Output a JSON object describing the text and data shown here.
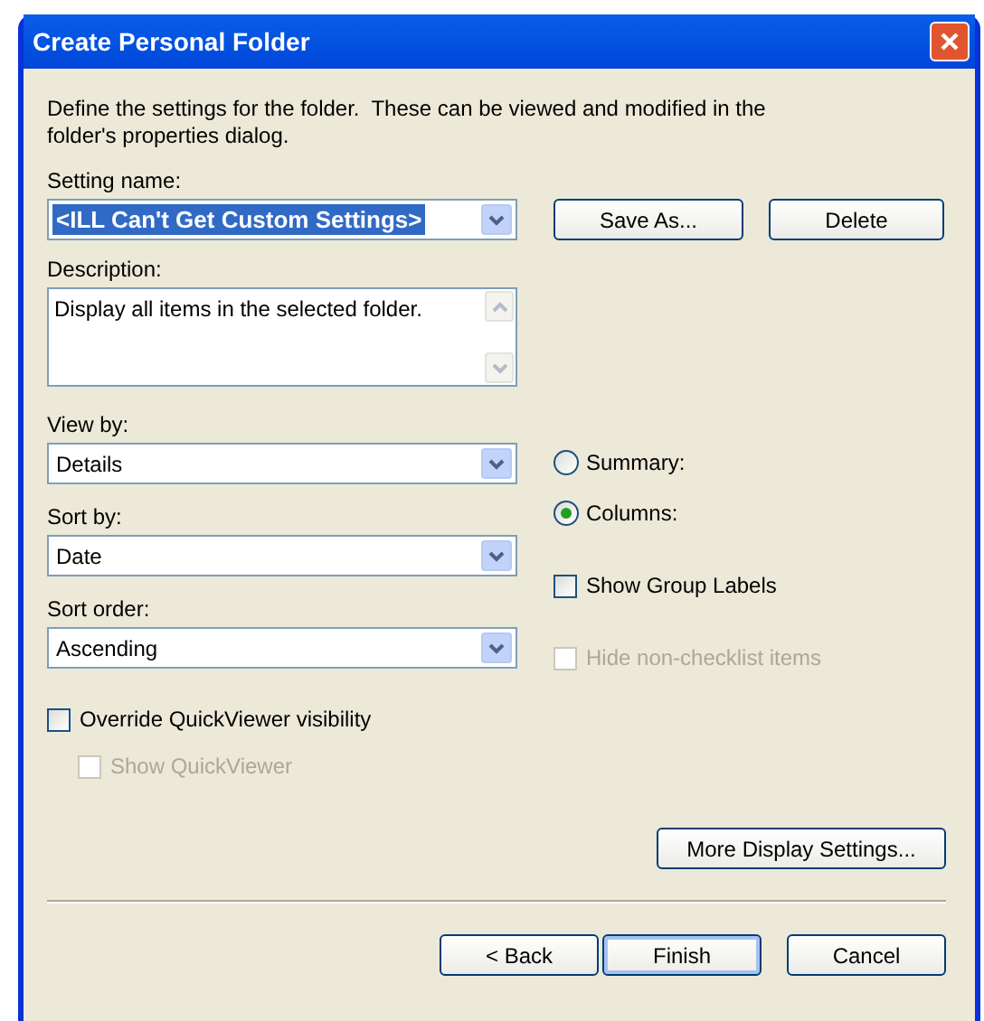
{
  "window": {
    "title": "Create Personal Folder"
  },
  "intro": "Define the settings for the folder.  These can be viewed and modified in the folder's properties dialog.",
  "setting_name": {
    "label": "Setting name:",
    "value": "<ILL Can't Get Custom Settings>",
    "selected": true
  },
  "setting_buttons": [
    "Save As...",
    "Delete"
  ],
  "description": {
    "label": "Description:",
    "value": "Display all items in the selected folder."
  },
  "dropdowns": [
    {
      "label": "View by:",
      "value": "Details"
    },
    {
      "label": "Sort by:",
      "value": "Date"
    },
    {
      "label": "Sort order:",
      "value": "Ascending"
    }
  ],
  "view_mode": [
    {
      "label": "Summary:",
      "selected": false
    },
    {
      "label": "Columns:",
      "selected": true
    }
  ],
  "right_checks": [
    {
      "label": "Show Group Labels",
      "checked": false,
      "disabled": false
    },
    {
      "label": "Hide non-checklist items",
      "checked": false,
      "disabled": true
    }
  ],
  "quickviewer": {
    "label": "Override QuickViewer visibility",
    "checked": false,
    "disabled": false,
    "children": [
      {
        "label": "Show QuickViewer",
        "checked": false,
        "disabled": true
      }
    ]
  },
  "more_button": "More Display Settings...",
  "nav_buttons": [
    {
      "label": "< Back",
      "default": false
    },
    {
      "label": "Finish",
      "default": true
    },
    {
      "label": "Cancel",
      "default": false
    }
  ]
}
